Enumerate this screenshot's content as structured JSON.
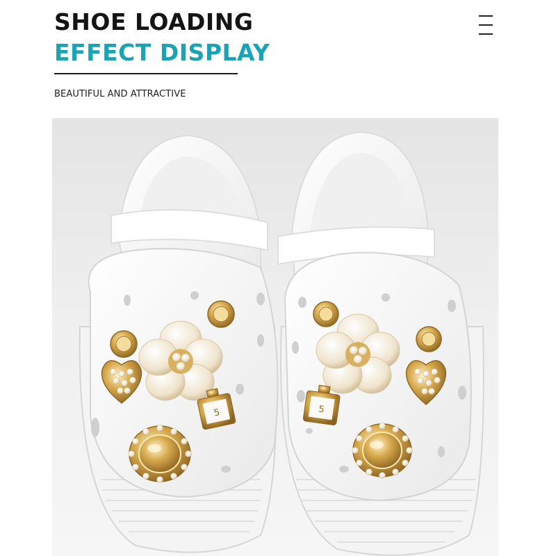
{
  "header": {
    "title_line_1": "SHOE LOADING",
    "title_line_2": "EFFECT DISPLAY",
    "subtitle": "BEAUTIFUL AND ATTRACTIVE",
    "menu_icon": "hamburger-menu-icon"
  },
  "colors": {
    "title_dark": "#141414",
    "title_accent": "#1aa3b5",
    "gold": "#c99a3c",
    "pearl": "#f4ecdc"
  },
  "product_image": {
    "icon": "white-clog-shoes-with-gold-pearl-charms"
  }
}
